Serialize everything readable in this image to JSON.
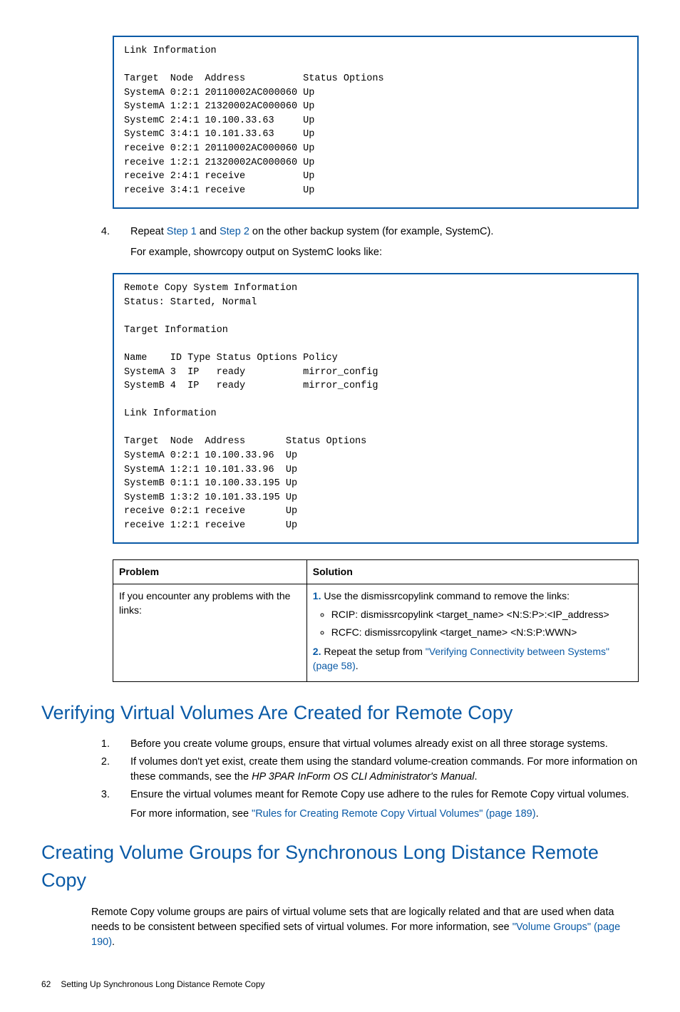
{
  "code_box_1": "Link Information\n\nTarget  Node  Address          Status Options\nSystemA 0:2:1 20110002AC000060 Up\nSystemA 1:2:1 21320002AC000060 Up\nSystemC 2:4:1 10.100.33.63     Up\nSystemC 3:4:1 10.101.33.63     Up\nreceive 0:2:1 20110002AC000060 Up\nreceive 1:2:1 21320002AC000060 Up\nreceive 2:4:1 receive          Up\nreceive 3:4:1 receive          Up",
  "step4": {
    "marker": "4.",
    "prefix": "Repeat ",
    "link1": "Step 1",
    "mid1": " and ",
    "link2": "Step 2",
    "suffix": " on the other backup system (for example, SystemC).",
    "example": "For example, showrcopy output on SystemC looks like:"
  },
  "code_box_2": "Remote Copy System Information\nStatus: Started, Normal\n\nTarget Information\n\nName    ID Type Status Options Policy\nSystemA 3  IP   ready          mirror_config\nSystemB 4  IP   ready          mirror_config\n\nLink Information\n\nTarget  Node  Address       Status Options\nSystemA 0:2:1 10.100.33.96  Up\nSystemA 1:2:1 10.101.33.96  Up\nSystemB 0:1:1 10.100.33.195 Up\nSystemB 1:3:2 10.101.33.195 Up\nreceive 0:2:1 receive       Up\nreceive 1:2:1 receive       Up",
  "table": {
    "head_problem": "Problem",
    "head_solution": "Solution",
    "problem_text": "If you encounter any problems with the links:",
    "sol1_num": "1.",
    "sol1_text": " Use the dismissrcopylink command to remove the links:",
    "sol1_b1": "RCIP: dismissrcopylink <target_name> <N:S:P>:<IP_address>",
    "sol1_b2": "RCFC: dismissrcopylink <target_name> <N:S:P:WWN>",
    "sol2_num": "2.",
    "sol2_text": " Repeat the setup from ",
    "sol2_link": "\"Verifying Connectivity between Systems\" (page 58)",
    "sol2_end": "."
  },
  "section1": {
    "title": "Verifying Virtual Volumes Are Created for Remote Copy",
    "li1": "Before you create volume groups, ensure that virtual volumes already exist on all three storage systems.",
    "li2_a": "If volumes don't yet exist, create them using the standard volume-creation commands. For more information on these commands, see the ",
    "li2_i": "HP 3PAR InForm OS CLI Administrator's Manual",
    "li2_b": ".",
    "li3": "Ensure the virtual volumes meant for Remote Copy use adhere to the rules for Remote Copy virtual volumes.",
    "li3_sub_a": "For more information, see ",
    "li3_sub_link": "\"Rules for Creating Remote Copy Virtual Volumes\" (page 189)",
    "li3_sub_b": "."
  },
  "section2": {
    "title": "Creating Volume Groups for Synchronous Long Distance Remote Copy",
    "para_a": "Remote Copy volume groups are pairs of virtual volume sets that are logically related and that are used when data needs to be consistent between specified sets of virtual volumes. For more information, see ",
    "para_link": "\"Volume Groups\" (page 190)",
    "para_b": "."
  },
  "footer": {
    "page_num": "62",
    "chapter": "Setting Up Synchronous Long Distance Remote Copy"
  }
}
